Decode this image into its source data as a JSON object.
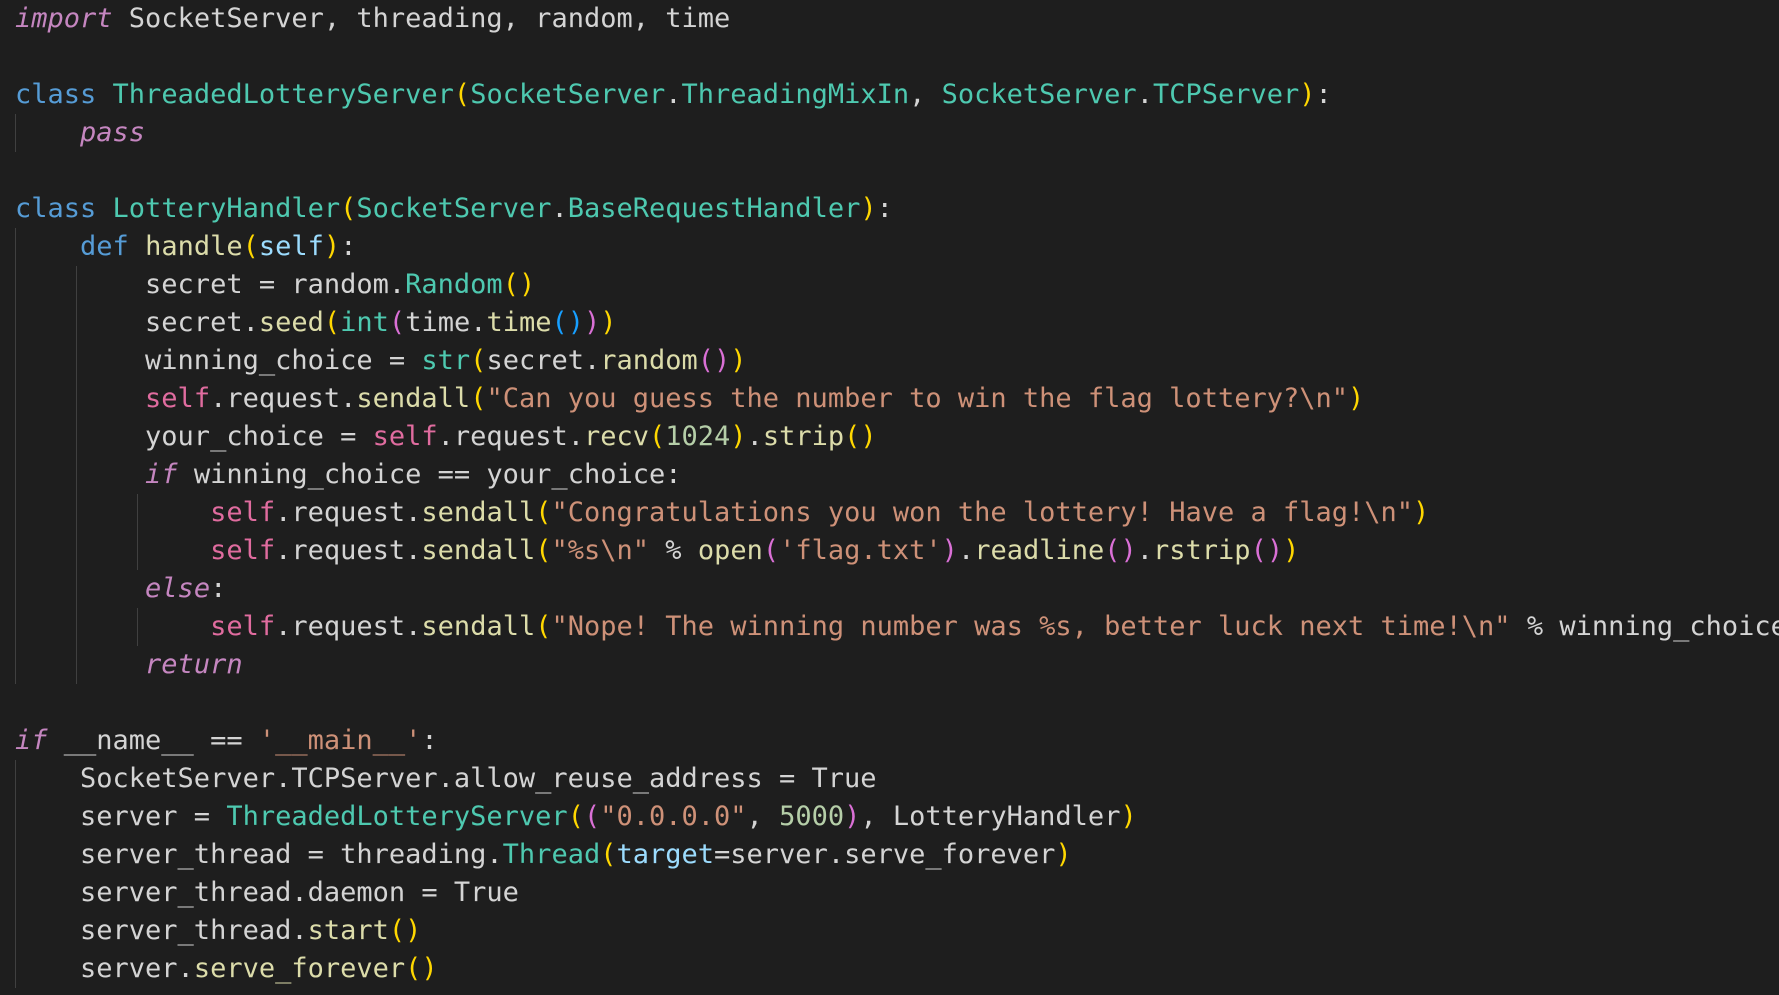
{
  "editor": {
    "language": "python",
    "theme_colors": {
      "background": "#1e1e1e",
      "keyword": "#569cd6",
      "control": "#c586c0",
      "class": "#4ec9b0",
      "string": "#ce9178",
      "function": "#dcdcaa",
      "bracket_1": "#ffd700",
      "bracket_2": "#da70d6",
      "bracket_3": "#179fff"
    },
    "lines": [
      {
        "indent": 0,
        "tokens": [
          [
            "ctrl",
            "import"
          ],
          [
            "txt",
            " SocketServer, threading, random, time"
          ]
        ]
      },
      {
        "indent": 0,
        "tokens": []
      },
      {
        "indent": 0,
        "tokens": [
          [
            "kw",
            "class"
          ],
          [
            "txt",
            " "
          ],
          [
            "cls",
            "ThreadedLotteryServer"
          ],
          [
            "br1",
            "("
          ],
          [
            "cls",
            "SocketServer"
          ],
          [
            "txt",
            "."
          ],
          [
            "cls",
            "ThreadingMixIn"
          ],
          [
            "txt",
            ", "
          ],
          [
            "cls",
            "SocketServer"
          ],
          [
            "txt",
            "."
          ],
          [
            "cls",
            "TCPServer"
          ],
          [
            "br1",
            ")"
          ],
          [
            "txt",
            ":"
          ]
        ]
      },
      {
        "indent": 1,
        "tokens": [
          [
            "txt",
            "    "
          ],
          [
            "ctrlit",
            "pass"
          ]
        ]
      },
      {
        "indent": 0,
        "tokens": []
      },
      {
        "indent": 0,
        "tokens": [
          [
            "kw",
            "class"
          ],
          [
            "txt",
            " "
          ],
          [
            "cls",
            "LotteryHandler"
          ],
          [
            "br1",
            "("
          ],
          [
            "cls",
            "SocketServer"
          ],
          [
            "txt",
            "."
          ],
          [
            "cls",
            "BaseRequestHandler"
          ],
          [
            "br1",
            ")"
          ],
          [
            "txt",
            ":"
          ]
        ]
      },
      {
        "indent": 1,
        "tokens": [
          [
            "txt",
            "    "
          ],
          [
            "def",
            "def"
          ],
          [
            "txt",
            " "
          ],
          [
            "fn",
            "handle"
          ],
          [
            "br1",
            "("
          ],
          [
            "pm",
            "self"
          ],
          [
            "br1",
            ")"
          ],
          [
            "txt",
            ":"
          ]
        ]
      },
      {
        "indent": 2,
        "tokens": [
          [
            "txt",
            "        secret = random."
          ],
          [
            "cls",
            "Random"
          ],
          [
            "br1",
            "()"
          ]
        ]
      },
      {
        "indent": 2,
        "tokens": [
          [
            "txt",
            "        secret."
          ],
          [
            "fn",
            "seed"
          ],
          [
            "br1",
            "("
          ],
          [
            "bi",
            "int"
          ],
          [
            "br2",
            "("
          ],
          [
            "txt",
            "time."
          ],
          [
            "fn",
            "time"
          ],
          [
            "br3",
            "()"
          ],
          [
            "br2",
            ")"
          ],
          [
            "br1",
            ")"
          ]
        ]
      },
      {
        "indent": 2,
        "tokens": [
          [
            "txt",
            "        winning_choice = "
          ],
          [
            "bi",
            "str"
          ],
          [
            "br1",
            "("
          ],
          [
            "txt",
            "secret."
          ],
          [
            "fn",
            "random"
          ],
          [
            "br2",
            "()"
          ],
          [
            "br1",
            ")"
          ]
        ]
      },
      {
        "indent": 2,
        "tokens": [
          [
            "txt",
            "        "
          ],
          [
            "slf",
            "self"
          ],
          [
            "txt",
            ".request."
          ],
          [
            "fn",
            "sendall"
          ],
          [
            "br1",
            "("
          ],
          [
            "str",
            "\"Can you guess the number to win the flag lottery?\\n\""
          ],
          [
            "br1",
            ")"
          ]
        ]
      },
      {
        "indent": 2,
        "tokens": [
          [
            "txt",
            "        your_choice = "
          ],
          [
            "slf",
            "self"
          ],
          [
            "txt",
            ".request."
          ],
          [
            "fn",
            "recv"
          ],
          [
            "br1",
            "("
          ],
          [
            "num",
            "1024"
          ],
          [
            "br1",
            ")"
          ],
          [
            "txt",
            "."
          ],
          [
            "fn",
            "strip"
          ],
          [
            "br1",
            "()"
          ]
        ]
      },
      {
        "indent": 2,
        "tokens": [
          [
            "txt",
            "        "
          ],
          [
            "ctrl",
            "if"
          ],
          [
            "txt",
            " winning_choice == your_choice:"
          ]
        ]
      },
      {
        "indent": 3,
        "tokens": [
          [
            "txt",
            "            "
          ],
          [
            "slf",
            "self"
          ],
          [
            "txt",
            ".request."
          ],
          [
            "fn",
            "sendall"
          ],
          [
            "br1",
            "("
          ],
          [
            "str",
            "\"Congratulations you won the lottery! Have a flag!\\n\""
          ],
          [
            "br1",
            ")"
          ]
        ]
      },
      {
        "indent": 3,
        "tokens": [
          [
            "txt",
            "            "
          ],
          [
            "slf",
            "self"
          ],
          [
            "txt",
            ".request."
          ],
          [
            "fn",
            "sendall"
          ],
          [
            "br1",
            "("
          ],
          [
            "str",
            "\"%s\\n\""
          ],
          [
            "txt",
            " % "
          ],
          [
            "fn",
            "open"
          ],
          [
            "br2",
            "("
          ],
          [
            "str",
            "'flag.txt'"
          ],
          [
            "br2",
            ")"
          ],
          [
            "txt",
            "."
          ],
          [
            "fn",
            "readline"
          ],
          [
            "br2",
            "()"
          ],
          [
            "txt",
            "."
          ],
          [
            "fn",
            "rstrip"
          ],
          [
            "br2",
            "()"
          ],
          [
            "br1",
            ")"
          ]
        ]
      },
      {
        "indent": 2,
        "tokens": [
          [
            "txt",
            "        "
          ],
          [
            "ctrl",
            "else"
          ],
          [
            "txt",
            ":"
          ]
        ]
      },
      {
        "indent": 3,
        "tokens": [
          [
            "txt",
            "            "
          ],
          [
            "slf",
            "self"
          ],
          [
            "txt",
            ".request."
          ],
          [
            "fn",
            "sendall"
          ],
          [
            "br1",
            "("
          ],
          [
            "str",
            "\"Nope! The winning number was %s, better luck next time!\\n\""
          ],
          [
            "txt",
            " % winning_choice"
          ],
          [
            "br1",
            ")"
          ]
        ]
      },
      {
        "indent": 2,
        "tokens": [
          [
            "txt",
            "        "
          ],
          [
            "ctrl",
            "return"
          ]
        ]
      },
      {
        "indent": 0,
        "tokens": []
      },
      {
        "indent": 0,
        "tokens": [
          [
            "ctrl",
            "if"
          ],
          [
            "txt",
            " __name__ == "
          ],
          [
            "str",
            "'__main__'"
          ],
          [
            "txt",
            ":"
          ]
        ]
      },
      {
        "indent": 1,
        "tokens": [
          [
            "txt",
            "    SocketServer.TCPServer.allow_reuse_address = True"
          ]
        ]
      },
      {
        "indent": 1,
        "tokens": [
          [
            "txt",
            "    server = "
          ],
          [
            "cls",
            "ThreadedLotteryServer"
          ],
          [
            "br1",
            "("
          ],
          [
            "br2",
            "("
          ],
          [
            "str",
            "\"0.0.0.0\""
          ],
          [
            "txt",
            ", "
          ],
          [
            "num",
            "5000"
          ],
          [
            "br2",
            ")"
          ],
          [
            "txt",
            ", LotteryHandler"
          ],
          [
            "br1",
            ")"
          ]
        ]
      },
      {
        "indent": 1,
        "tokens": [
          [
            "txt",
            "    server_thread = threading."
          ],
          [
            "cls",
            "Thread"
          ],
          [
            "br1",
            "("
          ],
          [
            "pm",
            "target"
          ],
          [
            "txt",
            "=server.serve_forever"
          ],
          [
            "br1",
            ")"
          ]
        ]
      },
      {
        "indent": 1,
        "tokens": [
          [
            "txt",
            "    server_thread.daemon = True"
          ]
        ]
      },
      {
        "indent": 1,
        "tokens": [
          [
            "txt",
            "    server_thread."
          ],
          [
            "fn",
            "start"
          ],
          [
            "br1",
            "()"
          ]
        ]
      },
      {
        "indent": 1,
        "tokens": [
          [
            "txt",
            "    server."
          ],
          [
            "fn",
            "serve_forever"
          ],
          [
            "br1",
            "()"
          ]
        ]
      }
    ]
  }
}
